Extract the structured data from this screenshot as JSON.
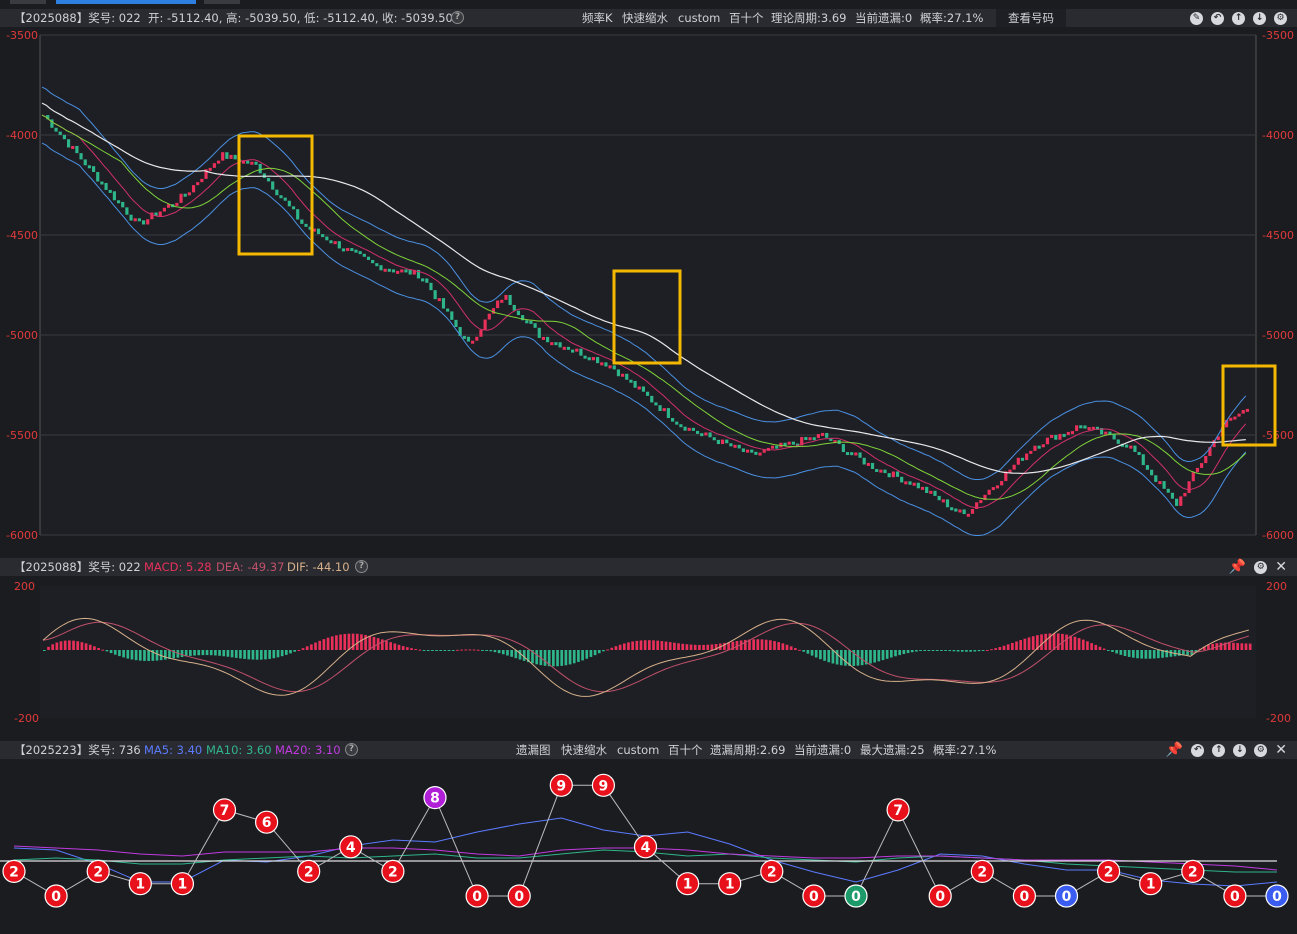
{
  "colors": {
    "up": "#e8305a",
    "down": "#2fb58a",
    "ma5": "#5b7bff",
    "ma10": "#2fb58a",
    "ma20": "#c03be0",
    "macd": "#e8305a",
    "dea": "#c0506a",
    "dif": "#d6b08a",
    "accent": "#f5b800",
    "axis": "#e03a3a"
  },
  "top": {
    "header_id": "【2025088】奖号: 022",
    "ohlc": "开: -5112.40, 高: -5039.50, 低: -5112.40, 收: -5039.50",
    "freq": "频率K",
    "mode": "快速缩水",
    "custom": "custom",
    "unit": "百十个",
    "theory": "理论周期:3.69",
    "miss": "当前遗漏:0",
    "prob": "概率:27.1%",
    "view_btn": "查看号码",
    "y_ticks": [
      "-3500",
      "-4000",
      "-4500",
      "-5000",
      "-5500",
      "-6000"
    ],
    "y_values": [
      -3500,
      -4000,
      -4500,
      -5000,
      -5500,
      -6000
    ]
  },
  "macd": {
    "header_id": "【2025088】奖号: 022",
    "macd_label": "MACD: 5.28",
    "dea_label": "DEA: -49.37",
    "dif_label": "DIF: -44.10",
    "y_ticks": [
      "200",
      "-200"
    ]
  },
  "bottom": {
    "header_id": "【2025223】奖号: 736",
    "ma5": "MA5: 3.40",
    "ma10": "MA10: 3.60",
    "ma20": "MA20: 3.10",
    "title": "遗漏图",
    "mode": "快速缩水",
    "custom": "custom",
    "unit": "百十个",
    "cycle": "遗漏周期:2.69",
    "miss": "当前遗漏:0",
    "max": "最大遗漏:25",
    "prob": "概率:27.1%",
    "nodes": [
      {
        "v": "2",
        "c": "red"
      },
      {
        "v": "0",
        "c": "red"
      },
      {
        "v": "2",
        "c": "red"
      },
      {
        "v": "1",
        "c": "red"
      },
      {
        "v": "1",
        "c": "red"
      },
      {
        "v": "7",
        "c": "red"
      },
      {
        "v": "6",
        "c": "red"
      },
      {
        "v": "2",
        "c": "red"
      },
      {
        "v": "4",
        "c": "red"
      },
      {
        "v": "2",
        "c": "red"
      },
      {
        "v": "8",
        "c": "purple"
      },
      {
        "v": "0",
        "c": "red"
      },
      {
        "v": "0",
        "c": "red"
      },
      {
        "v": "9",
        "c": "red"
      },
      {
        "v": "9",
        "c": "red"
      },
      {
        "v": "4",
        "c": "red"
      },
      {
        "v": "1",
        "c": "red"
      },
      {
        "v": "1",
        "c": "red"
      },
      {
        "v": "2",
        "c": "red"
      },
      {
        "v": "0",
        "c": "red"
      },
      {
        "v": "0",
        "c": "green"
      },
      {
        "v": "7",
        "c": "red"
      },
      {
        "v": "0",
        "c": "red"
      },
      {
        "v": "2",
        "c": "red"
      },
      {
        "v": "0",
        "c": "red"
      },
      {
        "v": "0",
        "c": "blue"
      },
      {
        "v": "2",
        "c": "red"
      },
      {
        "v": "1",
        "c": "red"
      },
      {
        "v": "2",
        "c": "red"
      },
      {
        "v": "0",
        "c": "red"
      },
      {
        "v": "0",
        "c": "blue"
      }
    ]
  }
}
